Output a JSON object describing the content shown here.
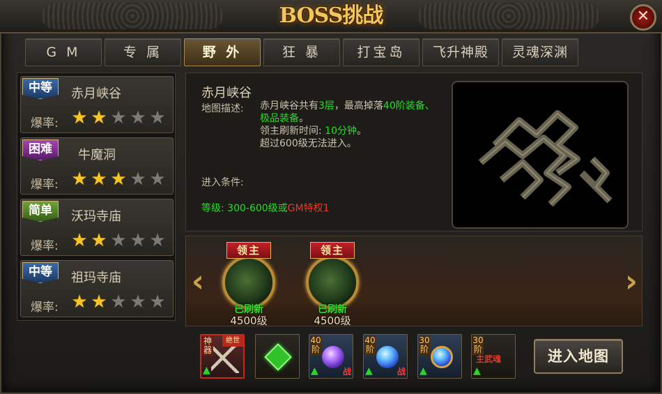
{
  "header": {
    "title": "BOSS挑战",
    "close_label": "✕"
  },
  "tabs": [
    {
      "label": "G M"
    },
    {
      "label": "专 属"
    },
    {
      "label": "野 外",
      "active": true
    },
    {
      "label": "狂 暴"
    },
    {
      "label": "打宝岛"
    },
    {
      "label": "飞升神殿"
    },
    {
      "label": "灵魂深渊"
    }
  ],
  "maps": [
    {
      "difficulty": "中等",
      "name": "赤月峡谷",
      "rate_label": "爆率:",
      "stars": 2,
      "max_stars": 5
    },
    {
      "difficulty": "困难",
      "name": "牛魔洞",
      "rate_label": "爆率:",
      "stars": 3,
      "max_stars": 5
    },
    {
      "difficulty": "简单",
      "name": "沃玛寺庙",
      "rate_label": "爆率:",
      "stars": 2,
      "max_stars": 5
    },
    {
      "difficulty": "中等",
      "name": "祖玛寺庙",
      "rate_label": "爆率:",
      "stars": 2,
      "max_stars": 5
    }
  ],
  "info": {
    "title": "赤月峡谷",
    "desc_label": "地图描述:",
    "desc_1a": "赤月峡谷共有",
    "desc_1b": "3层",
    "desc_1c": "，最高掉落",
    "desc_1d": "40阶装备、极品装备",
    "desc_1e": "。",
    "desc_2a": "领主刷新时间: ",
    "desc_2b": "10分钟",
    "desc_2c": "。",
    "desc_3": "超过600级无法进入。",
    "cond_label": "进入条件:",
    "cond_a": "等级: 300-600级或",
    "cond_b": "GM特权1"
  },
  "bosses": [
    {
      "flag": "领主",
      "status": "已刷新",
      "level": "4500级"
    },
    {
      "flag": "领主",
      "status": "已刷新",
      "level": "4500级"
    }
  ],
  "rewards": [
    {
      "tag": "神器",
      "corner": "绝世"
    },
    {
      "tag": ""
    },
    {
      "tag": "40阶",
      "extra": "战"
    },
    {
      "tag": "40阶",
      "extra": "战"
    },
    {
      "tag": "30阶"
    },
    {
      "tag": "30阶",
      "text": "主武魂"
    }
  ],
  "enter_button": "进入地图",
  "colors": {
    "accent_gold": "#f2c65a",
    "green": "#22e022",
    "red": "#e83a2a"
  }
}
